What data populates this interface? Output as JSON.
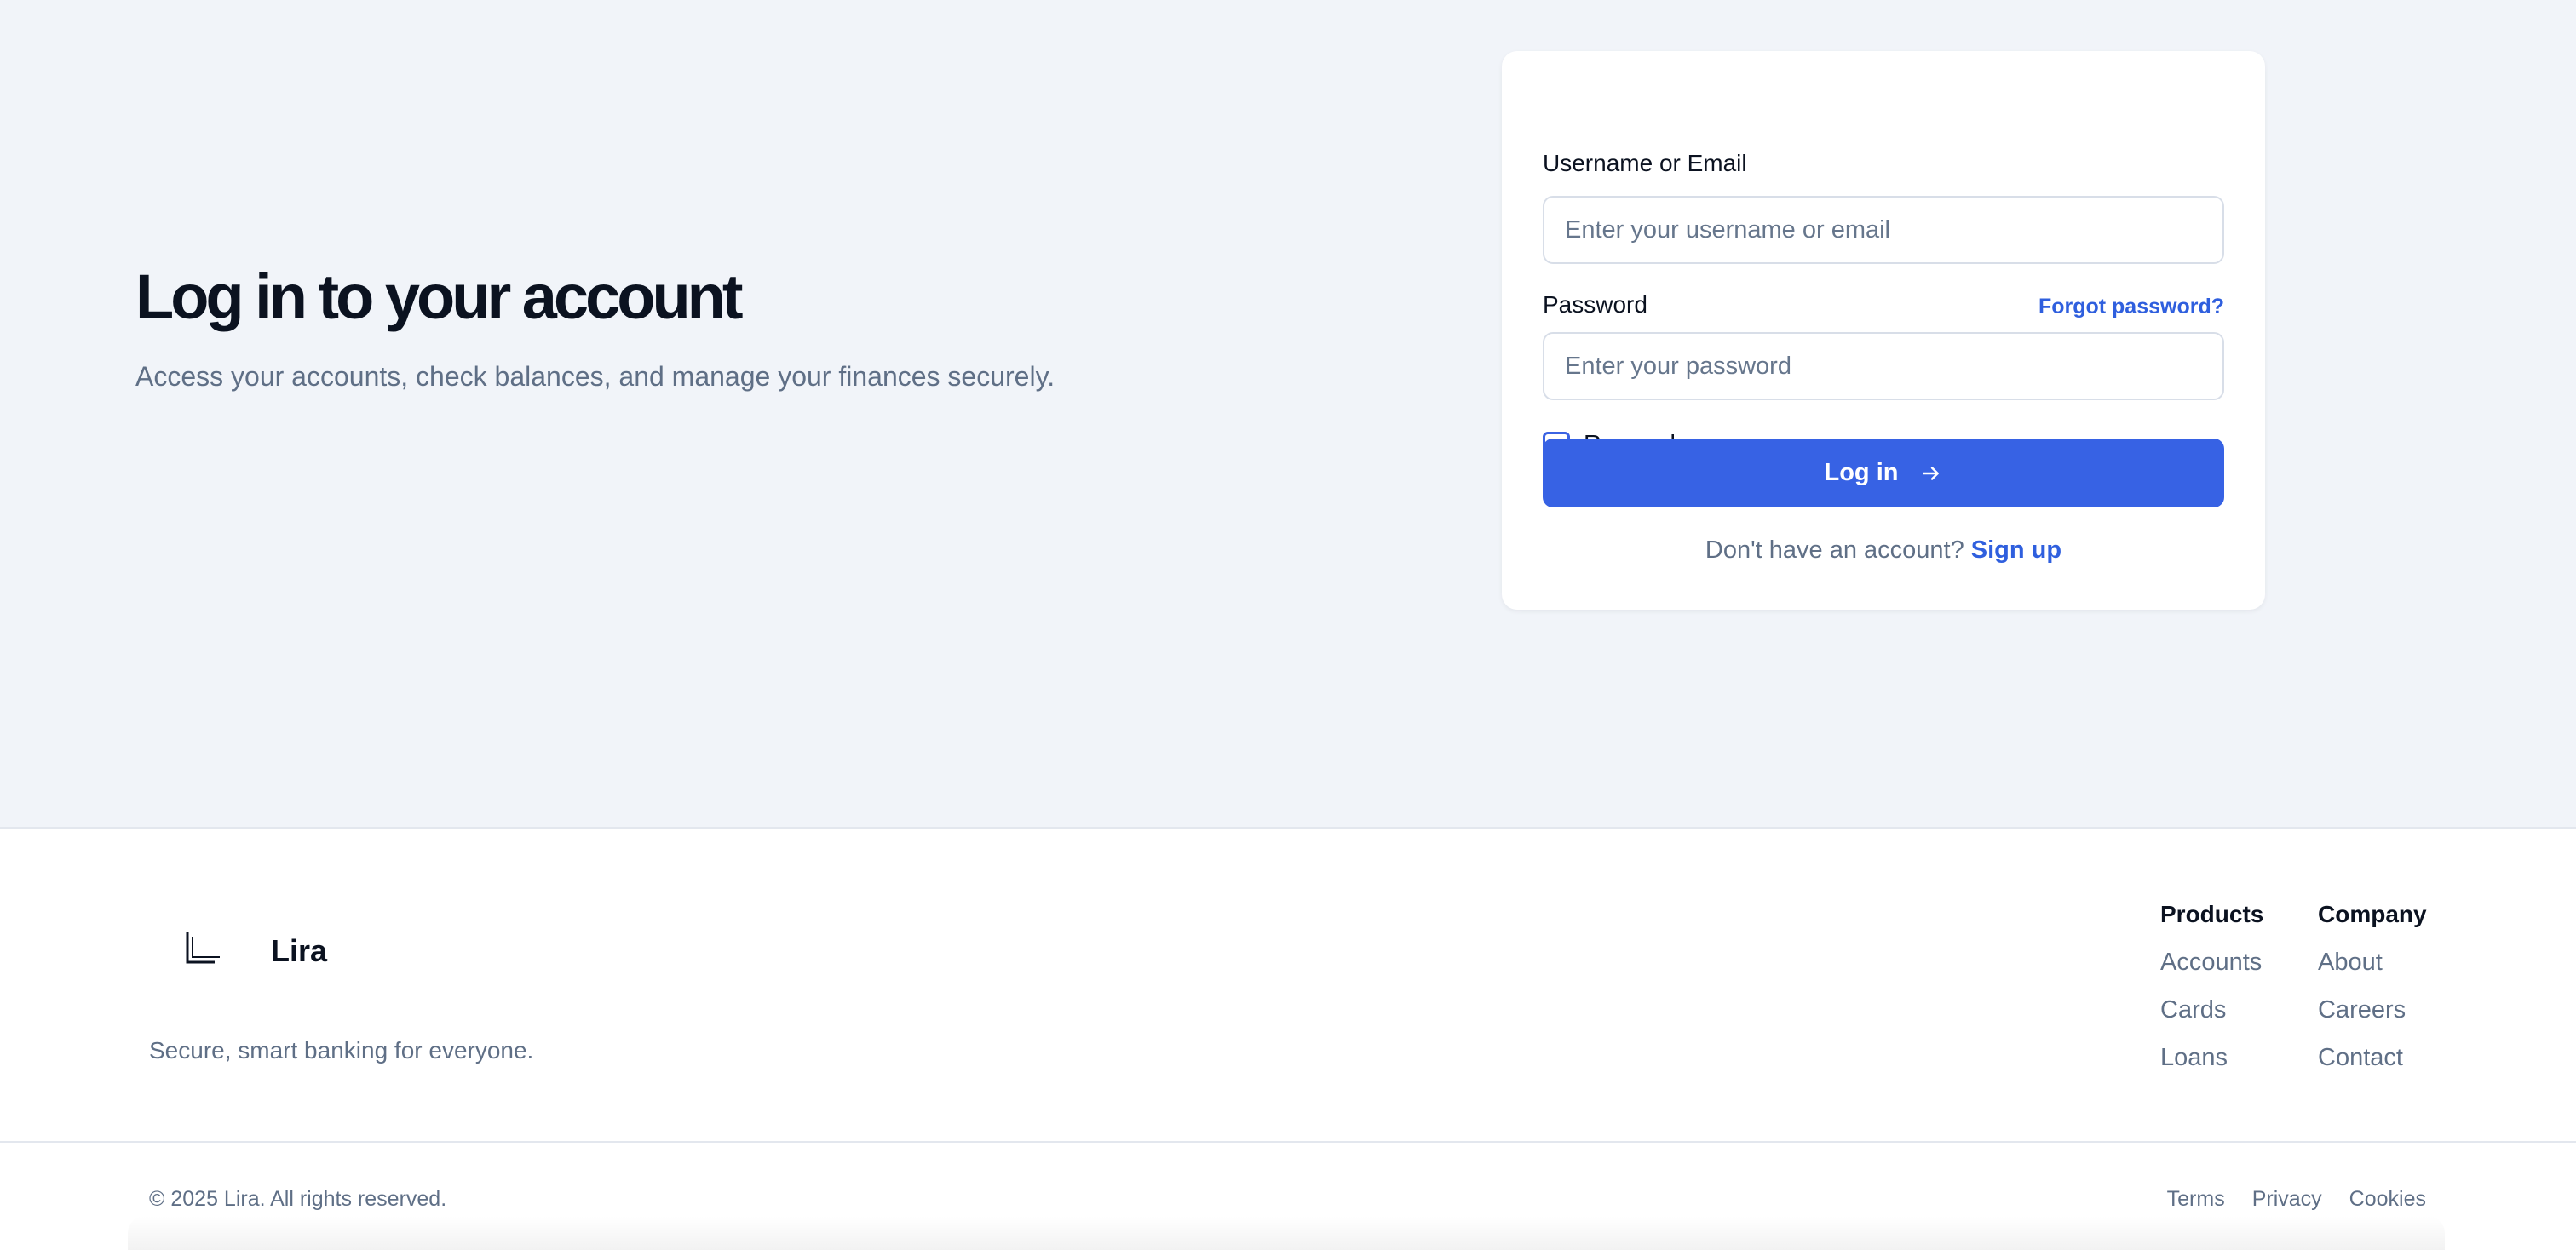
{
  "hero": {
    "title": "Log in to your account",
    "subtitle": "Access your accounts, check balances, and manage your finances securely."
  },
  "login_form": {
    "username_label": "Username or Email",
    "username_placeholder": "Enter your username or email",
    "username_value": "",
    "password_label": "Password",
    "forgot_password": "Forgot password?",
    "password_placeholder": "Enter your password",
    "password_value": "",
    "remember_me_label": "Remember me",
    "remember_me_checked": false,
    "login_button": "Log in",
    "login_button_icon": "arrow-right-icon",
    "signup_prompt": "Don't have an account?",
    "signup_link": "Sign up"
  },
  "footer": {
    "brand": "Lira",
    "logo_icon": "lira-logo-icon",
    "tagline": "Secure, smart banking for everyone.",
    "columns": [
      {
        "heading": "Products",
        "links": [
          "Accounts",
          "Cards",
          "Loans"
        ]
      },
      {
        "heading": "Company",
        "links": [
          "About",
          "Careers",
          "Contact"
        ]
      }
    ],
    "copyright": "© 2025 Lira. All rights reserved.",
    "legal_links": [
      "Terms",
      "Privacy",
      "Cookies"
    ]
  },
  "colors": {
    "accent": "#3762e4",
    "link": "#2f5fde",
    "page_background": "#f1f4f9",
    "muted_text": "#5f6f86",
    "heading_text": "#0b1220"
  }
}
